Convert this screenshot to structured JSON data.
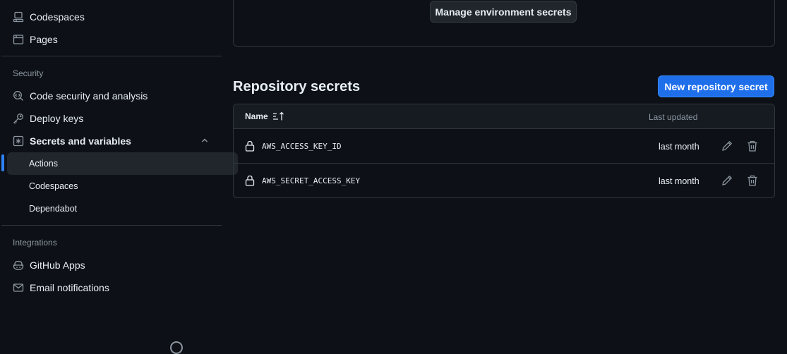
{
  "sidebar": {
    "items_top": [
      {
        "label": "Codespaces",
        "icon": "codespaces-icon"
      },
      {
        "label": "Pages",
        "icon": "browser-icon"
      }
    ],
    "security": {
      "label": "Security",
      "items": [
        {
          "label": "Code security and analysis",
          "icon": "codescan-icon"
        },
        {
          "label": "Deploy keys",
          "icon": "key-icon"
        },
        {
          "label": "Secrets and variables",
          "icon": "asterisk-icon",
          "expanded": true
        }
      ],
      "sub_items": [
        {
          "label": "Actions",
          "active": true
        },
        {
          "label": "Codespaces"
        },
        {
          "label": "Dependabot"
        }
      ]
    },
    "integrations": {
      "label": "Integrations",
      "items": [
        {
          "label": "GitHub Apps",
          "icon": "copilot-icon"
        },
        {
          "label": "Email notifications",
          "icon": "mail-icon"
        }
      ]
    }
  },
  "main": {
    "manage_env_button": "Manage environment secrets",
    "repo_secrets_title": "Repository secrets",
    "new_secret_button": "New repository secret",
    "table": {
      "col_name": "Name",
      "col_updated": "Last updated",
      "rows": [
        {
          "name": "AWS_ACCESS_KEY_ID",
          "updated": "last month"
        },
        {
          "name": "AWS_SECRET_ACCESS_KEY",
          "updated": "last month"
        }
      ]
    }
  },
  "colors": {
    "background": "#0d1117",
    "accent": "#2f81f7",
    "primary_button": "#1f6feb",
    "border": "#30363d",
    "muted_text": "#8d96a0"
  }
}
